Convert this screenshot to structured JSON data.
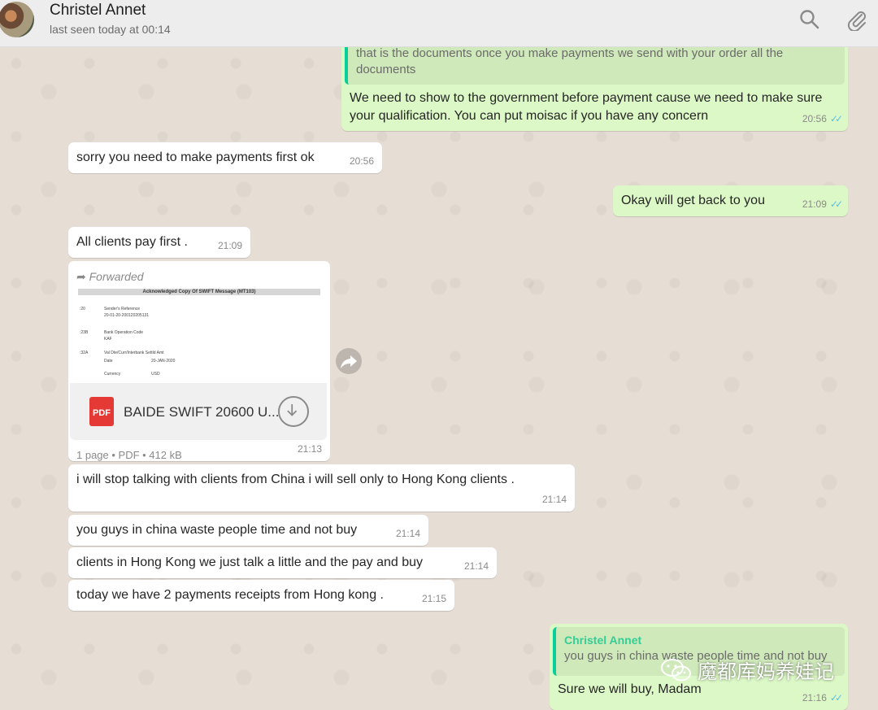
{
  "header": {
    "contact_name": "Christel Annet",
    "last_seen": "last seen today at 00:14"
  },
  "colors": {
    "incoming": "#ffffff",
    "outgoing": "#dcf8c6",
    "read_ticks": "#4fc3f7",
    "quote_bar": "#06cf9c"
  },
  "messages": {
    "m1": {
      "quote_text": "that is the documents once you make payments we send with your order all the documents",
      "text": "We need to show to the government before payment cause we need to make sure your qualification. You can put moisac if you have any concern",
      "time": "20:56"
    },
    "m2": {
      "text": "sorry you need to make payments first ok",
      "time": "20:56"
    },
    "m3": {
      "text": "Okay will get back to you",
      "time": "21:09"
    },
    "m4": {
      "text": "All clients pay first .",
      "time": "21:09"
    },
    "doc": {
      "forwarded_label": "Forwarded",
      "preview_title": "Acknowledged Copy Of SWIFT Message (MT103)",
      "preview_lines": [
        ":20",
        "Sender's Reference",
        "20-01-20-200120205131",
        ":23B",
        "Bank Operation Code",
        "KAF",
        ":32A",
        "Val Dte/Curr/Interbank Settld Amt",
        "Date",
        "20-JAN-2020",
        "Currency",
        "USD"
      ],
      "icon_label": "PDF",
      "file_name": "BAIDE SWIFT 20600 U...",
      "meta": "1 page • PDF • 412 kB",
      "time": "21:13"
    },
    "m5": {
      "text": "i will stop talking with clients from China i will sell only to Hong Kong clients .",
      "time": "21:14"
    },
    "m6": {
      "text": "you guys in china waste people time and not buy",
      "time": "21:14"
    },
    "m7": {
      "text": "clients in Hong Kong we just talk a little and the pay and buy",
      "time": "21:14"
    },
    "m8": {
      "text": "today we have 2 payments receipts from Hong kong .",
      "time": "21:15"
    },
    "m9": {
      "quote_name": "Christel Annet",
      "quote_text": "you guys in china waste people time and not buy",
      "text": "Sure we will buy, Madam",
      "time": "21:16"
    }
  },
  "watermark": {
    "text": "魔都库妈养娃记"
  }
}
